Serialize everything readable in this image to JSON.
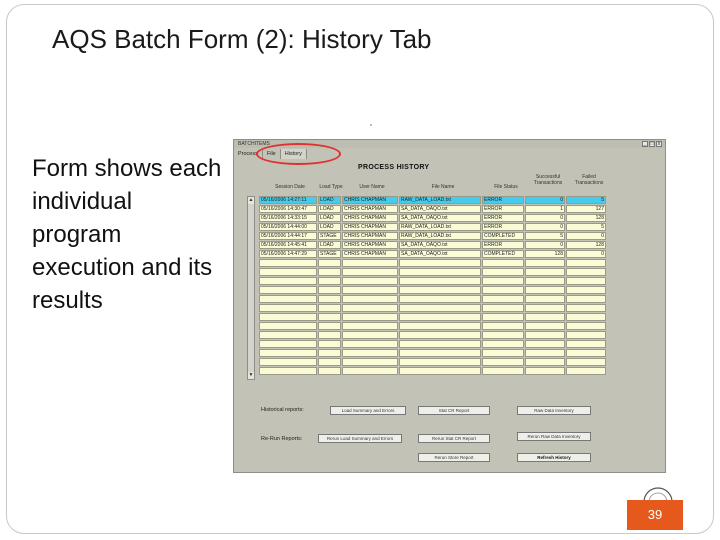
{
  "slide": {
    "title": "AQS Batch Form (2): History Tab",
    "body": "Form shows each individual program execution and its results",
    "page_number": "39"
  },
  "window": {
    "title": "BATCHITEMS",
    "tabs": [
      {
        "label": "Process"
      },
      {
        "label": "File"
      },
      {
        "label": "History",
        "selected": true
      }
    ],
    "controls": [
      "_",
      "□",
      "x"
    ]
  },
  "process_history": {
    "title": "PROCESS HISTORY",
    "columns": [
      "Session Date",
      "Load Type",
      "User Name",
      "File Name",
      "File Status",
      "Successful Transactions",
      "Failed Transactions"
    ],
    "rows": [
      [
        "05/16/2006 14:27:11",
        "LOAD",
        "CHRIS CHAPMAN",
        "RAW_DATA_LOAD.txt",
        "ERROR",
        "0",
        "5"
      ],
      [
        "05/16/2006 14:30:47",
        "LOAD",
        "CHRIS CHAPMAN",
        "SA_DATA_OAQO.txt",
        "ERROR",
        "1",
        "127"
      ],
      [
        "05/16/2006 14:33:15",
        "LOAD",
        "CHRIS CHAPMAN",
        "SA_DATA_OAQO.txt",
        "ERROR",
        "0",
        "128"
      ],
      [
        "05/16/2006 14:44:00",
        "LOAD",
        "CHRIS CHAPMAN",
        "RAW_DATA_LOAD.txt",
        "ERROR",
        "0",
        "5"
      ],
      [
        "05/16/2006 14:44:17",
        "STAGE",
        "CHRIS CHAPMAN",
        "RAW_DATA_LOAD.txt",
        "COMPLETED",
        "5",
        "0"
      ],
      [
        "05/16/2006 14:45:41",
        "LOAD",
        "CHRIS CHAPMAN",
        "SA_DATA_OAQO.txt",
        "ERROR",
        "0",
        "128"
      ],
      [
        "05/16/2006 14:47:29",
        "STAGE",
        "CHRIS CHAPMAN",
        "SA_DATA_OAQO.txt",
        "COMPLETED",
        "128",
        "0"
      ]
    ],
    "empty_rows": 13
  },
  "reports": {
    "historical_label": "Historical reports:",
    "rerun_label": "Re-Run Reports:",
    "buttons": {
      "load_summary": "Load Summary and Errors",
      "stat_cr": "Stat CR Report",
      "raw_inventory": "Raw Data Inventory",
      "rerun_load_summary": "Rerun Load Summary and Errors",
      "rerun_stat_cr": "Rerun Stat CR Report",
      "rerun_raw_inventory": "Rerun Raw Data Inventory",
      "rerun_store": "Rerun Store Report",
      "refresh_history": "Refresh History"
    }
  },
  "colors": {
    "form_bg": "#c2c2b7",
    "cell_bg": "#fbfbd6",
    "selected_row": "#44ccee",
    "highlight_ellipse": "#e03030",
    "page_badge": "#e55a1c"
  }
}
